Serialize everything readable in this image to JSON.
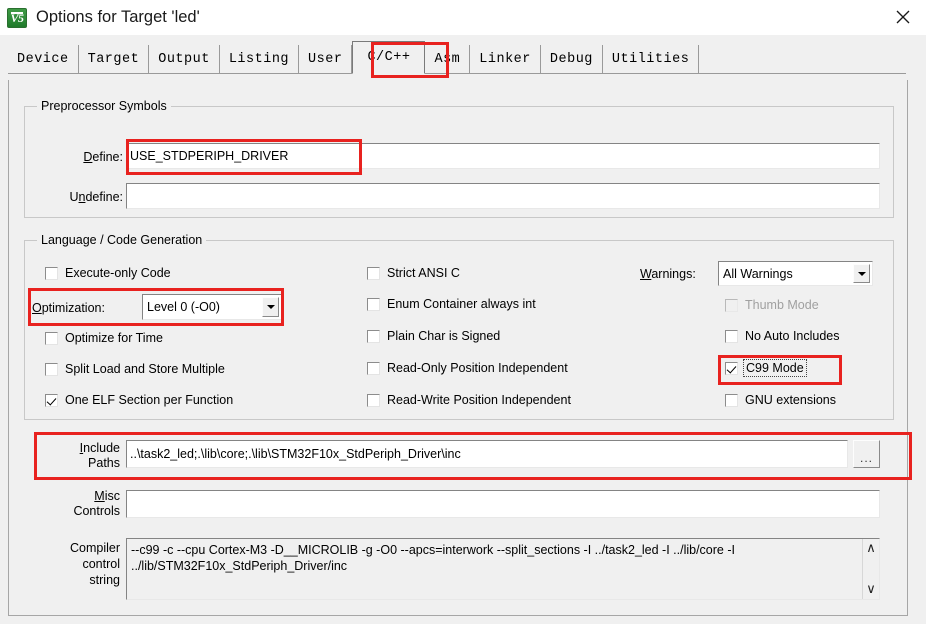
{
  "window": {
    "title": "Options for Target 'led'",
    "icon": "uvision-logo-icon",
    "close_label": "✕"
  },
  "tabs": [
    {
      "label": "Device",
      "selected": false
    },
    {
      "label": "Target",
      "selected": false
    },
    {
      "label": "Output",
      "selected": false
    },
    {
      "label": "Listing",
      "selected": false
    },
    {
      "label": "User",
      "selected": false
    },
    {
      "label": "C/C++",
      "selected": true
    },
    {
      "label": "Asm",
      "selected": false
    },
    {
      "label": "Linker",
      "selected": false
    },
    {
      "label": "Debug",
      "selected": false
    },
    {
      "label": "Utilities",
      "selected": false
    }
  ],
  "preprocessor": {
    "group_title": "Preprocessor Symbols",
    "define_label": "Define:",
    "define_value": "USE_STDPERIPH_DRIVER",
    "undefine_label": "Undefine:",
    "undefine_value": ""
  },
  "language": {
    "group_title": "Language / Code Generation",
    "left_column": [
      {
        "label": "Execute-only Code",
        "checked": false,
        "disabled": false
      },
      {
        "label": "Optimize for Time",
        "checked": false,
        "disabled": false
      },
      {
        "label": "Split Load and Store Multiple",
        "checked": false,
        "disabled": false
      },
      {
        "label": "One ELF Section per Function",
        "checked": true,
        "disabled": false
      }
    ],
    "optimization_label": "Optimization:",
    "optimization_value": "Level 0 (-O0)",
    "middle_column": [
      {
        "label": "Strict ANSI C",
        "checked": false,
        "disabled": false
      },
      {
        "label": "Enum Container always int",
        "checked": false,
        "disabled": false
      },
      {
        "label": "Plain Char is Signed",
        "checked": false,
        "disabled": false
      },
      {
        "label": "Read-Only Position Independent",
        "checked": false,
        "disabled": false
      },
      {
        "label": "Read-Write Position Independent",
        "checked": false,
        "disabled": false
      }
    ],
    "warnings_label": "Warnings:",
    "warnings_value": "All Warnings",
    "right_column": [
      {
        "label": "Thumb Mode",
        "checked": false,
        "disabled": true,
        "focused": false
      },
      {
        "label": "No Auto Includes",
        "checked": false,
        "disabled": false,
        "focused": false
      },
      {
        "label": "C99 Mode",
        "checked": true,
        "disabled": false,
        "focused": true
      },
      {
        "label": "GNU extensions",
        "checked": false,
        "disabled": false,
        "focused": false
      }
    ]
  },
  "paths": {
    "include_label_line1": "Include",
    "include_label_line2": "Paths",
    "include_value": "..\\task2_led;.\\lib\\core;.\\lib\\STM32F10x_StdPeriph_Driver\\inc",
    "browse_label": "...",
    "misc_label_line1": "Misc",
    "misc_label_line2": "Controls",
    "misc_value": ""
  },
  "compiler": {
    "label_line1": "Compiler",
    "label_line2": "control",
    "label_line3": "string",
    "value": "--c99 -c --cpu Cortex-M3 -D__MICROLIB -g -O0 --apcs=interwork --split_sections -I ../task2_led -I ../lib/core -I ../lib/STM32F10x_StdPeriph_Driver/inc",
    "scroll_up_icon": "∧",
    "scroll_down_icon": "∨"
  },
  "annotations": {
    "highlight_color": "#e8221f",
    "boxes": [
      {
        "name": "highlight-tab-cpp"
      },
      {
        "name": "highlight-define-field"
      },
      {
        "name": "highlight-optimization"
      },
      {
        "name": "highlight-c99-mode"
      },
      {
        "name": "highlight-include-paths"
      }
    ]
  }
}
